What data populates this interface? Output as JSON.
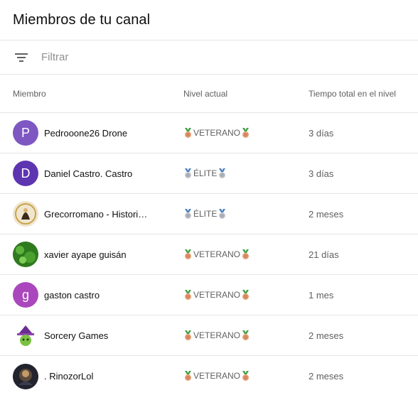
{
  "page": {
    "title": "Miembros de tu canal"
  },
  "filter": {
    "placeholder": "Filtrar",
    "icon": "filter-list-icon"
  },
  "table": {
    "columns": {
      "member": "Miembro",
      "level": "Nivel actual",
      "time": "Tiempo total en el nivel"
    },
    "rows": [
      {
        "name": "Pedrooone26 Drone",
        "level": "VETERANO",
        "level_medal": "veteran-medal-icon",
        "time": "3 días",
        "avatar_letter": "P",
        "avatar_color": "#7e57c2"
      },
      {
        "name": "Daniel Castro. Castro",
        "level": "ÉLITE",
        "level_medal": "elite-medal-icon",
        "time": "3 días",
        "avatar_letter": "D",
        "avatar_color": "#5e35b1"
      },
      {
        "name": "Grecorromano - Histori…",
        "level": "ÉLITE",
        "level_medal": "elite-medal-icon",
        "time": "2 meses",
        "avatar_letter": "",
        "avatar_color": "#e8d9b8"
      },
      {
        "name": "xavier ayape guisán",
        "level": "VETERANO",
        "level_medal": "veteran-medal-icon",
        "time": "21 días",
        "avatar_letter": "",
        "avatar_color": "#3e8e2a"
      },
      {
        "name": "gaston castro",
        "level": "VETERANO",
        "level_medal": "veteran-medal-icon",
        "time": "1 mes",
        "avatar_letter": "g",
        "avatar_color": "#ab47bc"
      },
      {
        "name": "Sorcery Games",
        "level": "VETERANO",
        "level_medal": "veteran-medal-icon",
        "time": "2 meses",
        "avatar_letter": "",
        "avatar_color": "#ffffff"
      },
      {
        "name": ". RinozorLol",
        "level": "VETERANO",
        "level_medal": "veteran-medal-icon",
        "time": "2 meses",
        "avatar_letter": "",
        "avatar_color": "#2a2a3a"
      }
    ]
  }
}
